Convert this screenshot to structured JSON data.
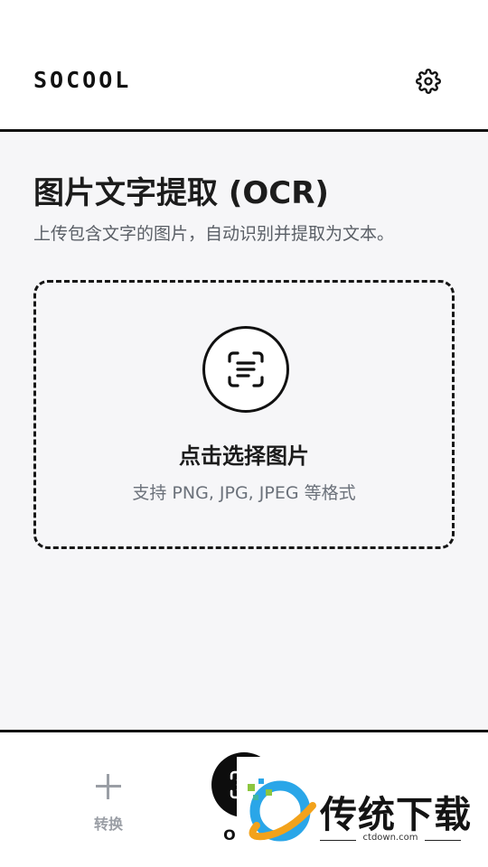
{
  "header": {
    "app_title": "SOCOOL",
    "settings_icon": "gear-icon"
  },
  "main": {
    "title": "图片文字提取 (OCR)",
    "subtitle": "上传包含文字的图片，自动识别并提取为文本。",
    "upload": {
      "icon": "document-scan-icon",
      "title": "点击选择图片",
      "hint": "支持 PNG, JPG, JPEG 等格式"
    }
  },
  "bottom_nav": {
    "items": [
      {
        "label": "转换",
        "icon": "plus-icon",
        "active": false
      },
      {
        "label": "OCR",
        "icon": "document-scan-icon",
        "active": true
      }
    ]
  },
  "watermark": {
    "brand_text": "传统下载",
    "url": "ctdown.com",
    "logo_icon": "ctdown-logo-icon"
  },
  "colors": {
    "background": "#f6f6f8",
    "accent": "#111111",
    "muted": "#9a9ea5",
    "subtitle": "#5a5f66"
  }
}
